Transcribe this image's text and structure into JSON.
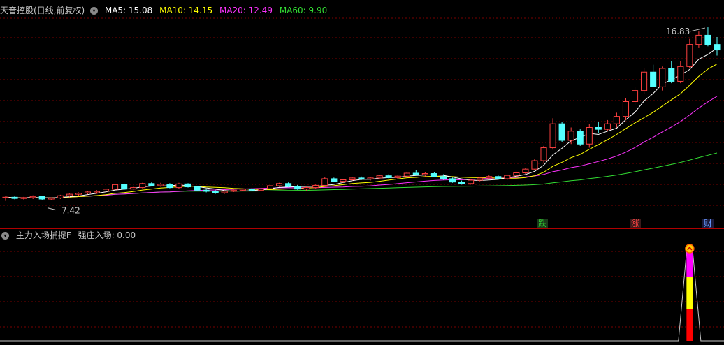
{
  "main_panel": {
    "title": "天音控股(日线,前复权)",
    "ma": [
      {
        "label": "MA5: 15.08",
        "color": "#ffffff"
      },
      {
        "label": "MA10: 14.15",
        "color": "#ffff00"
      },
      {
        "label": "MA20: 12.49",
        "color": "#ff33ff"
      },
      {
        "label": "MA60: 9.90",
        "color": "#33dd33"
      }
    ],
    "high_label": "16.83",
    "low_label": "7.42",
    "badges": [
      {
        "text": "跌",
        "color": "#33cc33",
        "bg": "#1a3a1a"
      },
      {
        "text": "涨",
        "color": "#ff4444",
        "bg": "#3a1a1a"
      },
      {
        "text": "财",
        "color": "#6699ff",
        "bg": "#1a1a3a"
      }
    ]
  },
  "sub_panel": {
    "title": "主力入场捕捉F",
    "value_label": "强庄入场: 0.00"
  },
  "colors": {
    "up": "#ff4040",
    "down": "#54ffff",
    "grid": "#7a0000",
    "ma5": "#ffffff",
    "ma10": "#ffff00",
    "ma20": "#ff33ff",
    "ma60": "#33dd33"
  },
  "chart_data": [
    {
      "type": "candlestick",
      "title": "天音控股(日线,前复权)",
      "ylim": [
        6.8,
        17.4
      ],
      "candles": [
        [
          7.58,
          7.68,
          7.42,
          7.62
        ],
        [
          7.62,
          7.7,
          7.5,
          7.55
        ],
        [
          7.55,
          7.64,
          7.48,
          7.6
        ],
        [
          7.6,
          7.72,
          7.52,
          7.66
        ],
        [
          7.66,
          7.7,
          7.48,
          7.52
        ],
        [
          7.52,
          7.62,
          7.45,
          7.58
        ],
        [
          7.58,
          7.75,
          7.52,
          7.7
        ],
        [
          7.7,
          7.82,
          7.62,
          7.78
        ],
        [
          7.78,
          7.88,
          7.7,
          7.84
        ],
        [
          7.84,
          7.95,
          7.78,
          7.9
        ],
        [
          7.9,
          8.0,
          7.8,
          7.95
        ],
        [
          7.95,
          8.1,
          7.88,
          8.05
        ],
        [
          8.05,
          8.35,
          8.0,
          8.3
        ],
        [
          8.3,
          8.36,
          8.02,
          8.06
        ],
        [
          8.06,
          8.2,
          8.0,
          8.14
        ],
        [
          8.14,
          8.4,
          8.1,
          8.36
        ],
        [
          8.36,
          8.42,
          8.2,
          8.24
        ],
        [
          8.24,
          8.4,
          8.18,
          8.32
        ],
        [
          8.32,
          8.38,
          8.1,
          8.14
        ],
        [
          8.14,
          8.4,
          8.08,
          8.34
        ],
        [
          8.34,
          8.38,
          8.14,
          8.18
        ],
        [
          8.18,
          8.22,
          7.96,
          8.0
        ],
        [
          8.0,
          8.06,
          7.88,
          7.94
        ],
        [
          7.94,
          8.0,
          7.8,
          7.86
        ],
        [
          7.86,
          7.98,
          7.8,
          7.94
        ],
        [
          7.94,
          8.04,
          7.9,
          8.0
        ],
        [
          8.0,
          8.1,
          7.94,
          8.06
        ],
        [
          8.06,
          8.12,
          7.96,
          8.0
        ],
        [
          8.0,
          8.12,
          7.94,
          8.08
        ],
        [
          8.08,
          8.3,
          8.02,
          8.24
        ],
        [
          8.24,
          8.4,
          8.18,
          8.36
        ],
        [
          8.36,
          8.42,
          8.16,
          8.2
        ],
        [
          8.2,
          8.28,
          8.02,
          8.06
        ],
        [
          8.06,
          8.2,
          7.96,
          8.14
        ],
        [
          8.14,
          8.3,
          8.08,
          8.26
        ],
        [
          8.26,
          8.7,
          8.2,
          8.62
        ],
        [
          8.62,
          8.68,
          8.44,
          8.48
        ],
        [
          8.48,
          8.6,
          8.4,
          8.56
        ],
        [
          8.56,
          8.72,
          8.5,
          8.66
        ],
        [
          8.66,
          8.74,
          8.54,
          8.6
        ],
        [
          8.6,
          8.7,
          8.52,
          8.66
        ],
        [
          8.66,
          8.84,
          8.6,
          8.78
        ],
        [
          8.78,
          8.86,
          8.64,
          8.68
        ],
        [
          8.68,
          8.8,
          8.6,
          8.76
        ],
        [
          8.76,
          9.0,
          8.7,
          8.92
        ],
        [
          8.92,
          9.1,
          8.8,
          8.84
        ],
        [
          8.84,
          8.96,
          8.74,
          8.9
        ],
        [
          8.9,
          8.98,
          8.7,
          8.74
        ],
        [
          8.74,
          8.86,
          8.56,
          8.62
        ],
        [
          8.62,
          8.68,
          8.4,
          8.44
        ],
        [
          8.44,
          8.52,
          8.3,
          8.36
        ],
        [
          8.36,
          8.6,
          8.3,
          8.54
        ],
        [
          8.54,
          8.7,
          8.48,
          8.66
        ],
        [
          8.66,
          8.8,
          8.6,
          8.74
        ],
        [
          8.74,
          8.82,
          8.58,
          8.62
        ],
        [
          8.62,
          8.84,
          8.56,
          8.8
        ],
        [
          8.8,
          9.0,
          8.74,
          8.94
        ],
        [
          8.94,
          9.2,
          8.88,
          9.14
        ],
        [
          9.14,
          9.7,
          9.1,
          9.6
        ],
        [
          9.6,
          10.4,
          9.5,
          10.3
        ],
        [
          10.3,
          11.9,
          10.2,
          11.6
        ],
        [
          11.6,
          11.7,
          10.6,
          10.7
        ],
        [
          10.7,
          11.4,
          10.5,
          11.2
        ],
        [
          11.2,
          11.3,
          10.4,
          10.5
        ],
        [
          10.5,
          11.6,
          10.3,
          11.4
        ],
        [
          11.4,
          11.7,
          11.1,
          11.3
        ],
        [
          11.3,
          11.8,
          11.2,
          11.6
        ],
        [
          11.6,
          12.2,
          11.4,
          12.0
        ],
        [
          12.0,
          13.0,
          11.8,
          12.8
        ],
        [
          12.8,
          13.6,
          12.6,
          13.4
        ],
        [
          13.4,
          14.6,
          13.2,
          14.4
        ],
        [
          14.4,
          14.8,
          13.6,
          13.6
        ],
        [
          13.6,
          14.7,
          13.4,
          14.6
        ],
        [
          14.6,
          15.0,
          13.8,
          13.9
        ],
        [
          13.9,
          15.0,
          13.8,
          14.7
        ],
        [
          14.7,
          16.2,
          14.6,
          15.9
        ],
        [
          15.9,
          16.6,
          15.7,
          16.4
        ],
        [
          16.4,
          16.83,
          15.8,
          15.9
        ],
        [
          15.9,
          16.3,
          15.3,
          15.6
        ]
      ]
    },
    {
      "type": "bar",
      "title": "主力入场捕捉F",
      "ylim": [
        0,
        1
      ],
      "highlight_index": 75
    }
  ]
}
